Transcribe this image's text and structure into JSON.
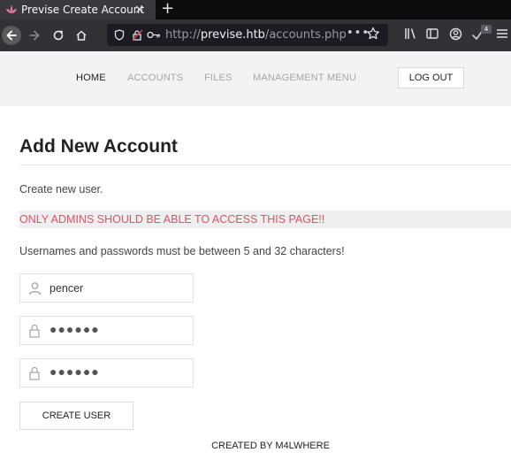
{
  "browser": {
    "tab_title": "Previse Create Account",
    "tab_close": "×",
    "new_tab": "+",
    "url_protocol": "http://",
    "url_host": "previse.htb",
    "url_path": "/accounts.php",
    "url_more": "•••",
    "notification_count": "4"
  },
  "nav": {
    "items": [
      "HOME",
      "ACCOUNTS",
      "FILES",
      "MANAGEMENT MENU"
    ],
    "active": "HOME",
    "logout_label": "LOG OUT"
  },
  "main": {
    "title": "Add New Account",
    "intro": "Create new user.",
    "warning": "ONLY ADMINS SHOULD BE ABLE TO ACCESS THIS PAGE!!",
    "rule": "Usernames and passwords must be between 5 and 32 characters!",
    "username_value": "pencer",
    "password_mask": "●●●●●●",
    "confirm_mask": "●●●●●●",
    "submit_label": "CREATE USER"
  },
  "footer": {
    "text": "CREATED BY M4LWHERE"
  },
  "colors": {
    "warning": "#e0506e",
    "header_bg": "#f3f3f3",
    "browser_bg": "#323234"
  }
}
